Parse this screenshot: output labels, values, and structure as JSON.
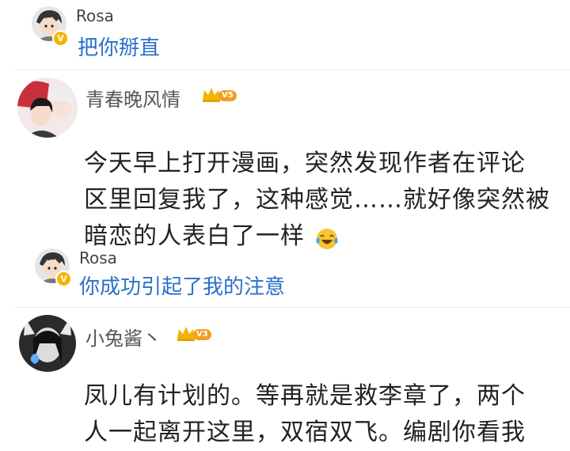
{
  "thread": [
    {
      "kind": "reply",
      "user": "Rosa",
      "verified": true,
      "text": "把你掰直"
    },
    {
      "kind": "comment",
      "user": "青春晚风情",
      "badge": "V5",
      "lines": [
        "今天早上打开漫画，突然发现作者在评论",
        "区里回复我了，这种感觉……就好像突然被",
        "暗恋的人表白了一样"
      ],
      "emoji": "laughing-tears-emoji"
    },
    {
      "kind": "reply",
      "user": "Rosa",
      "verified": true,
      "text": "你成功引起了我的注意"
    },
    {
      "kind": "comment",
      "user": "小兔酱丶",
      "badge": "V3",
      "lines": [
        "凤儿有计划的。等再就是救李章了，两个",
        "人一起离开这里，双宿双飞。编剧你看我"
      ]
    }
  ],
  "colors": {
    "reply_text": "#2b6fc9",
    "verified_badge": "#f5b400",
    "crown": "#f5b400",
    "vip_tag": "#f0a020"
  }
}
